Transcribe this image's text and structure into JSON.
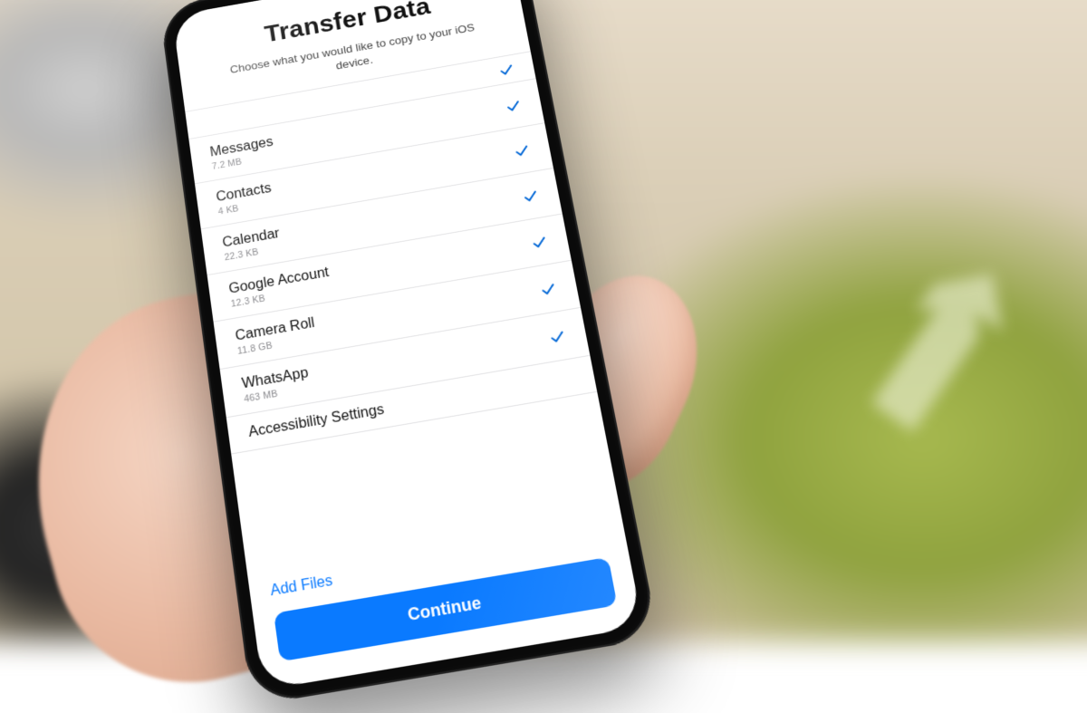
{
  "header": {
    "title": "Transfer Data",
    "subtitle": "Choose what you would like to copy to your iOS device."
  },
  "leading_check": true,
  "items": [
    {
      "label": "Messages",
      "size": "7.2 MB",
      "checked": true
    },
    {
      "label": "Contacts",
      "size": "4 KB",
      "checked": true
    },
    {
      "label": "Calendar",
      "size": "22.3 KB",
      "checked": true
    },
    {
      "label": "Google Account",
      "size": "12.3 KB",
      "checked": true
    },
    {
      "label": "Camera Roll",
      "size": "11.8 GB",
      "checked": true
    },
    {
      "label": "WhatsApp",
      "size": "463 MB",
      "checked": true
    },
    {
      "label": "Accessibility Settings",
      "size": "",
      "checked": false
    }
  ],
  "footer": {
    "add_files_label": "Add Files",
    "continue_label": "Continue"
  },
  "colors": {
    "accent": "#0a7aff",
    "check": "#0066d6"
  }
}
